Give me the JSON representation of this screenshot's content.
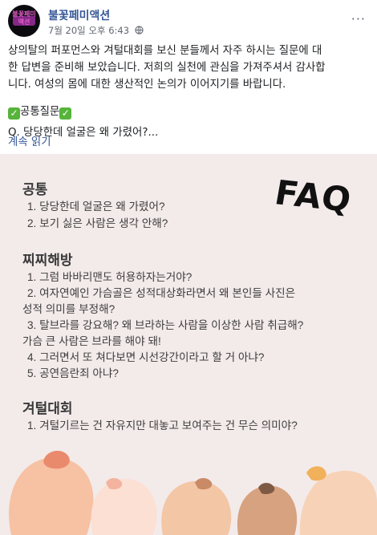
{
  "post": {
    "page_name": "불꽃페미액션",
    "avatar_text": "불꽃페미액션",
    "date": "7월 20일 오후 6:43",
    "body_line1": "상의탈의 퍼포먼스와 겨털대회를 보신 분들께서 자주 하시는 질문에 대",
    "body_line2": "한 답변을 준비해 보았습니다. 저희의 실천에 관심을 가져주셔서 감사합",
    "body_line3": "니다. 여성의 몸에 대한 생산적인 논의가 이어지기를 바랍니다.",
    "tag": "공통질문",
    "question": "Q. 당당한데 얼굴은 왜 가렸어?...",
    "read_more": "계속 읽기"
  },
  "faq_image": {
    "badge": "FAQ",
    "sections": [
      {
        "title": "공통",
        "items": [
          "1. 당당한데 얼굴은 왜 가렸어?",
          "2. 보기 싫은 사람은 생각 안해?"
        ]
      },
      {
        "title": "찌찌해방",
        "items": [
          "1. 그럼 바바리맨도 허용하자는거야?",
          "2. 여자연예인 가슴골은 성적대상화라면서 왜 본인들 사진은",
          "성적 의미를 부정해?",
          "3. 탈브라를 강요해? 왜 브라하는 사람을 이상한 사람 취급해?",
          "가슴 큰 사람은 브라를 해야 돼!",
          "4. 그러면서 또 쳐다보면 시선강간이라고 할 거 아냐?",
          "5. 공연음란죄 아냐?"
        ]
      },
      {
        "title": "겨털대회",
        "items": [
          "1. 겨털기르는 건 자유지만 대놓고 보여주는 건 무슨 의미야?"
        ]
      }
    ]
  },
  "colors": {
    "link": "#385898",
    "panel_bg": "#f3eaea",
    "tag_check": "#56b43a"
  },
  "icons": [
    "globe-icon",
    "more-icon",
    "check-icon"
  ]
}
